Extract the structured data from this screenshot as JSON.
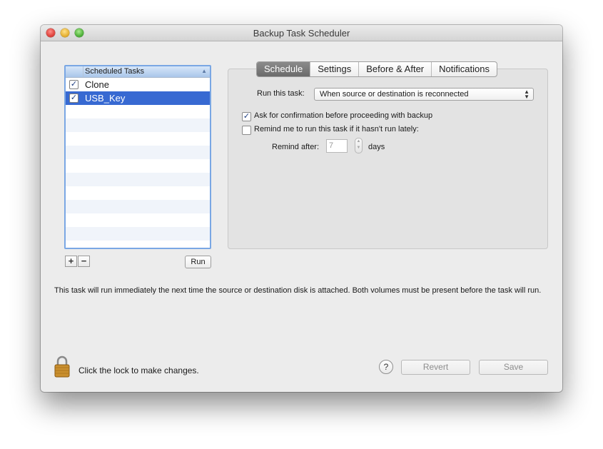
{
  "window": {
    "title": "Backup Task Scheduler"
  },
  "task_list": {
    "header": "Scheduled Tasks",
    "items": [
      {
        "name": "Clone",
        "checked": true,
        "selected": false
      },
      {
        "name": "USB_Key",
        "checked": true,
        "selected": true
      }
    ],
    "add_label": "+",
    "remove_label": "−",
    "run_label": "Run"
  },
  "tabs": [
    "Schedule",
    "Settings",
    "Before & After",
    "Notifications"
  ],
  "active_tab": "Schedule",
  "schedule": {
    "run_label": "Run this task:",
    "run_value": "When source or destination is reconnected",
    "confirm_label": "Ask for confirmation before proceeding with backup",
    "confirm_checked": true,
    "remind_label": "Remind me to run this task if it hasn't run lately:",
    "remind_checked": false,
    "remind_after_label": "Remind after:",
    "remind_after_value": "7",
    "days_label": "days"
  },
  "description": "This task will run immediately the next time the source or destination disk is attached. Both volumes must be present before the task will run.",
  "footer": {
    "lock_label": "Click the lock to make changes.",
    "help_label": "?",
    "revert_label": "Revert",
    "save_label": "Save"
  },
  "icons": [
    "lock-icon",
    "help-icon",
    "checkmark-icon",
    "sort-arrow-icon",
    "updown-arrow-icon"
  ]
}
